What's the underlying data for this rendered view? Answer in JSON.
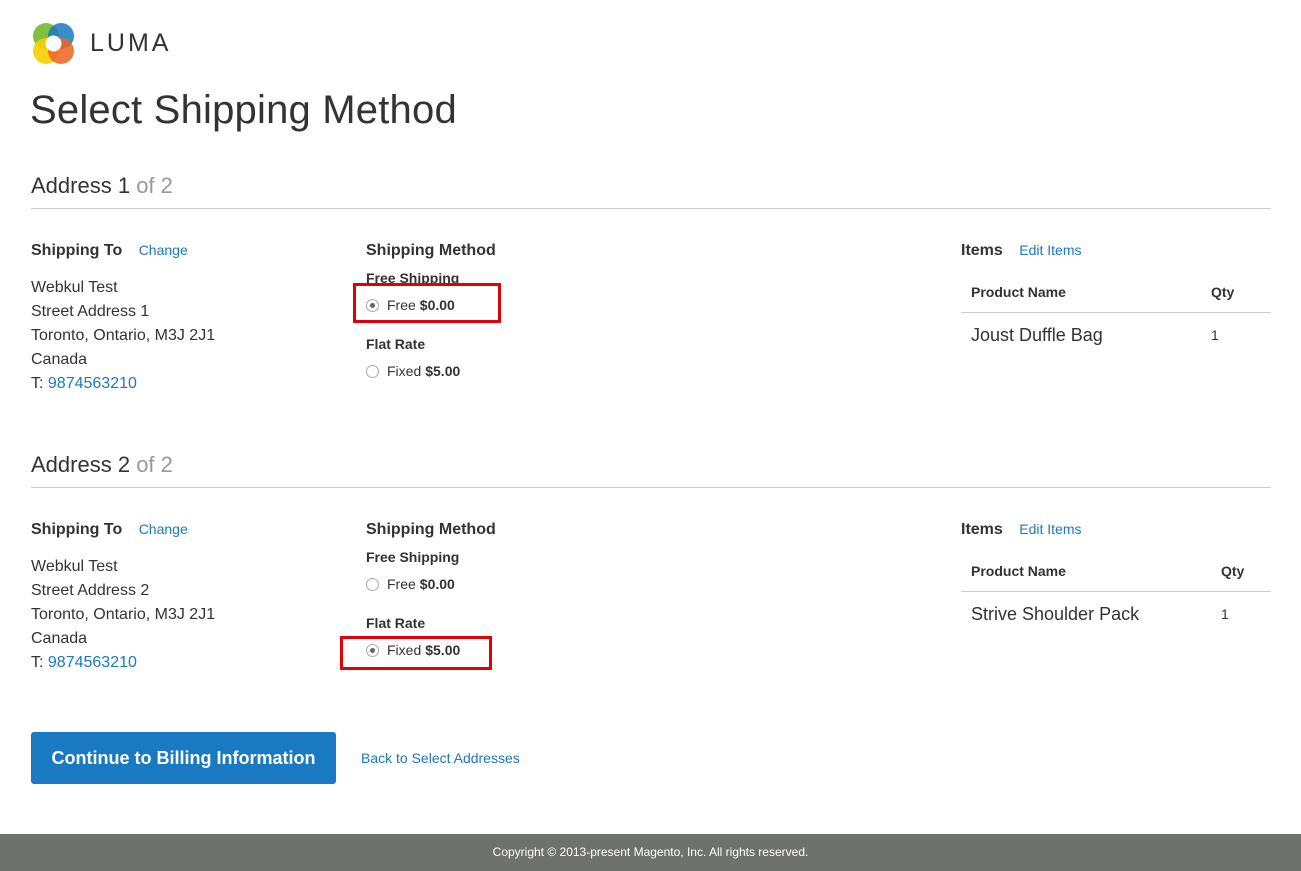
{
  "brand": {
    "name": "LUMA"
  },
  "page": {
    "title": "Select Shipping Method"
  },
  "addresses": [
    {
      "index_label": "Address 1",
      "of_label": "of 2",
      "shipping_to_title": "Shipping To",
      "change_label": "Change",
      "lines": [
        "Webkul Test",
        "Street Address 1",
        "Toronto, Ontario, M3J 2J1",
        "Canada"
      ],
      "phone_prefix": "T:",
      "phone": "9874563210",
      "method_title": "Shipping Method",
      "methods": [
        {
          "group": "Free Shipping",
          "option": "Free",
          "price": "$0.00",
          "selected": true
        },
        {
          "group": "Flat Rate",
          "option": "Fixed",
          "price": "$5.00",
          "selected": false
        }
      ],
      "items_title": "Items",
      "edit_items_label": "Edit Items",
      "table_headers": [
        "Product Name",
        "Qty"
      ],
      "items": [
        {
          "name": "Joust Duffle Bag",
          "qty": "1"
        }
      ]
    },
    {
      "index_label": "Address 2",
      "of_label": "of 2",
      "shipping_to_title": "Shipping To",
      "change_label": "Change",
      "lines": [
        "Webkul Test",
        "Street Address 2",
        "Toronto, Ontario, M3J 2J1",
        "Canada"
      ],
      "phone_prefix": "T:",
      "phone": "9874563210",
      "method_title": "Shipping Method",
      "methods": [
        {
          "group": "Free Shipping",
          "option": "Free",
          "price": "$0.00",
          "selected": false
        },
        {
          "group": "Flat Rate",
          "option": "Fixed",
          "price": "$5.00",
          "selected": true
        }
      ],
      "items_title": "Items",
      "edit_items_label": "Edit Items",
      "table_headers": [
        "Product Name",
        "Qty"
      ],
      "items": [
        {
          "name": "Strive Shoulder Pack",
          "qty": "1"
        }
      ]
    }
  ],
  "actions": {
    "continue_label": "Continue to Billing Information",
    "back_label": "Back to Select Addresses"
  },
  "footer": {
    "copyright": "Copyright © 2013-present Magento, Inc. All rights reserved."
  },
  "colors": {
    "link": "#1979c3",
    "button": "#1979c3",
    "highlight": "#e0000a",
    "footer_bg": "#6e716e"
  }
}
